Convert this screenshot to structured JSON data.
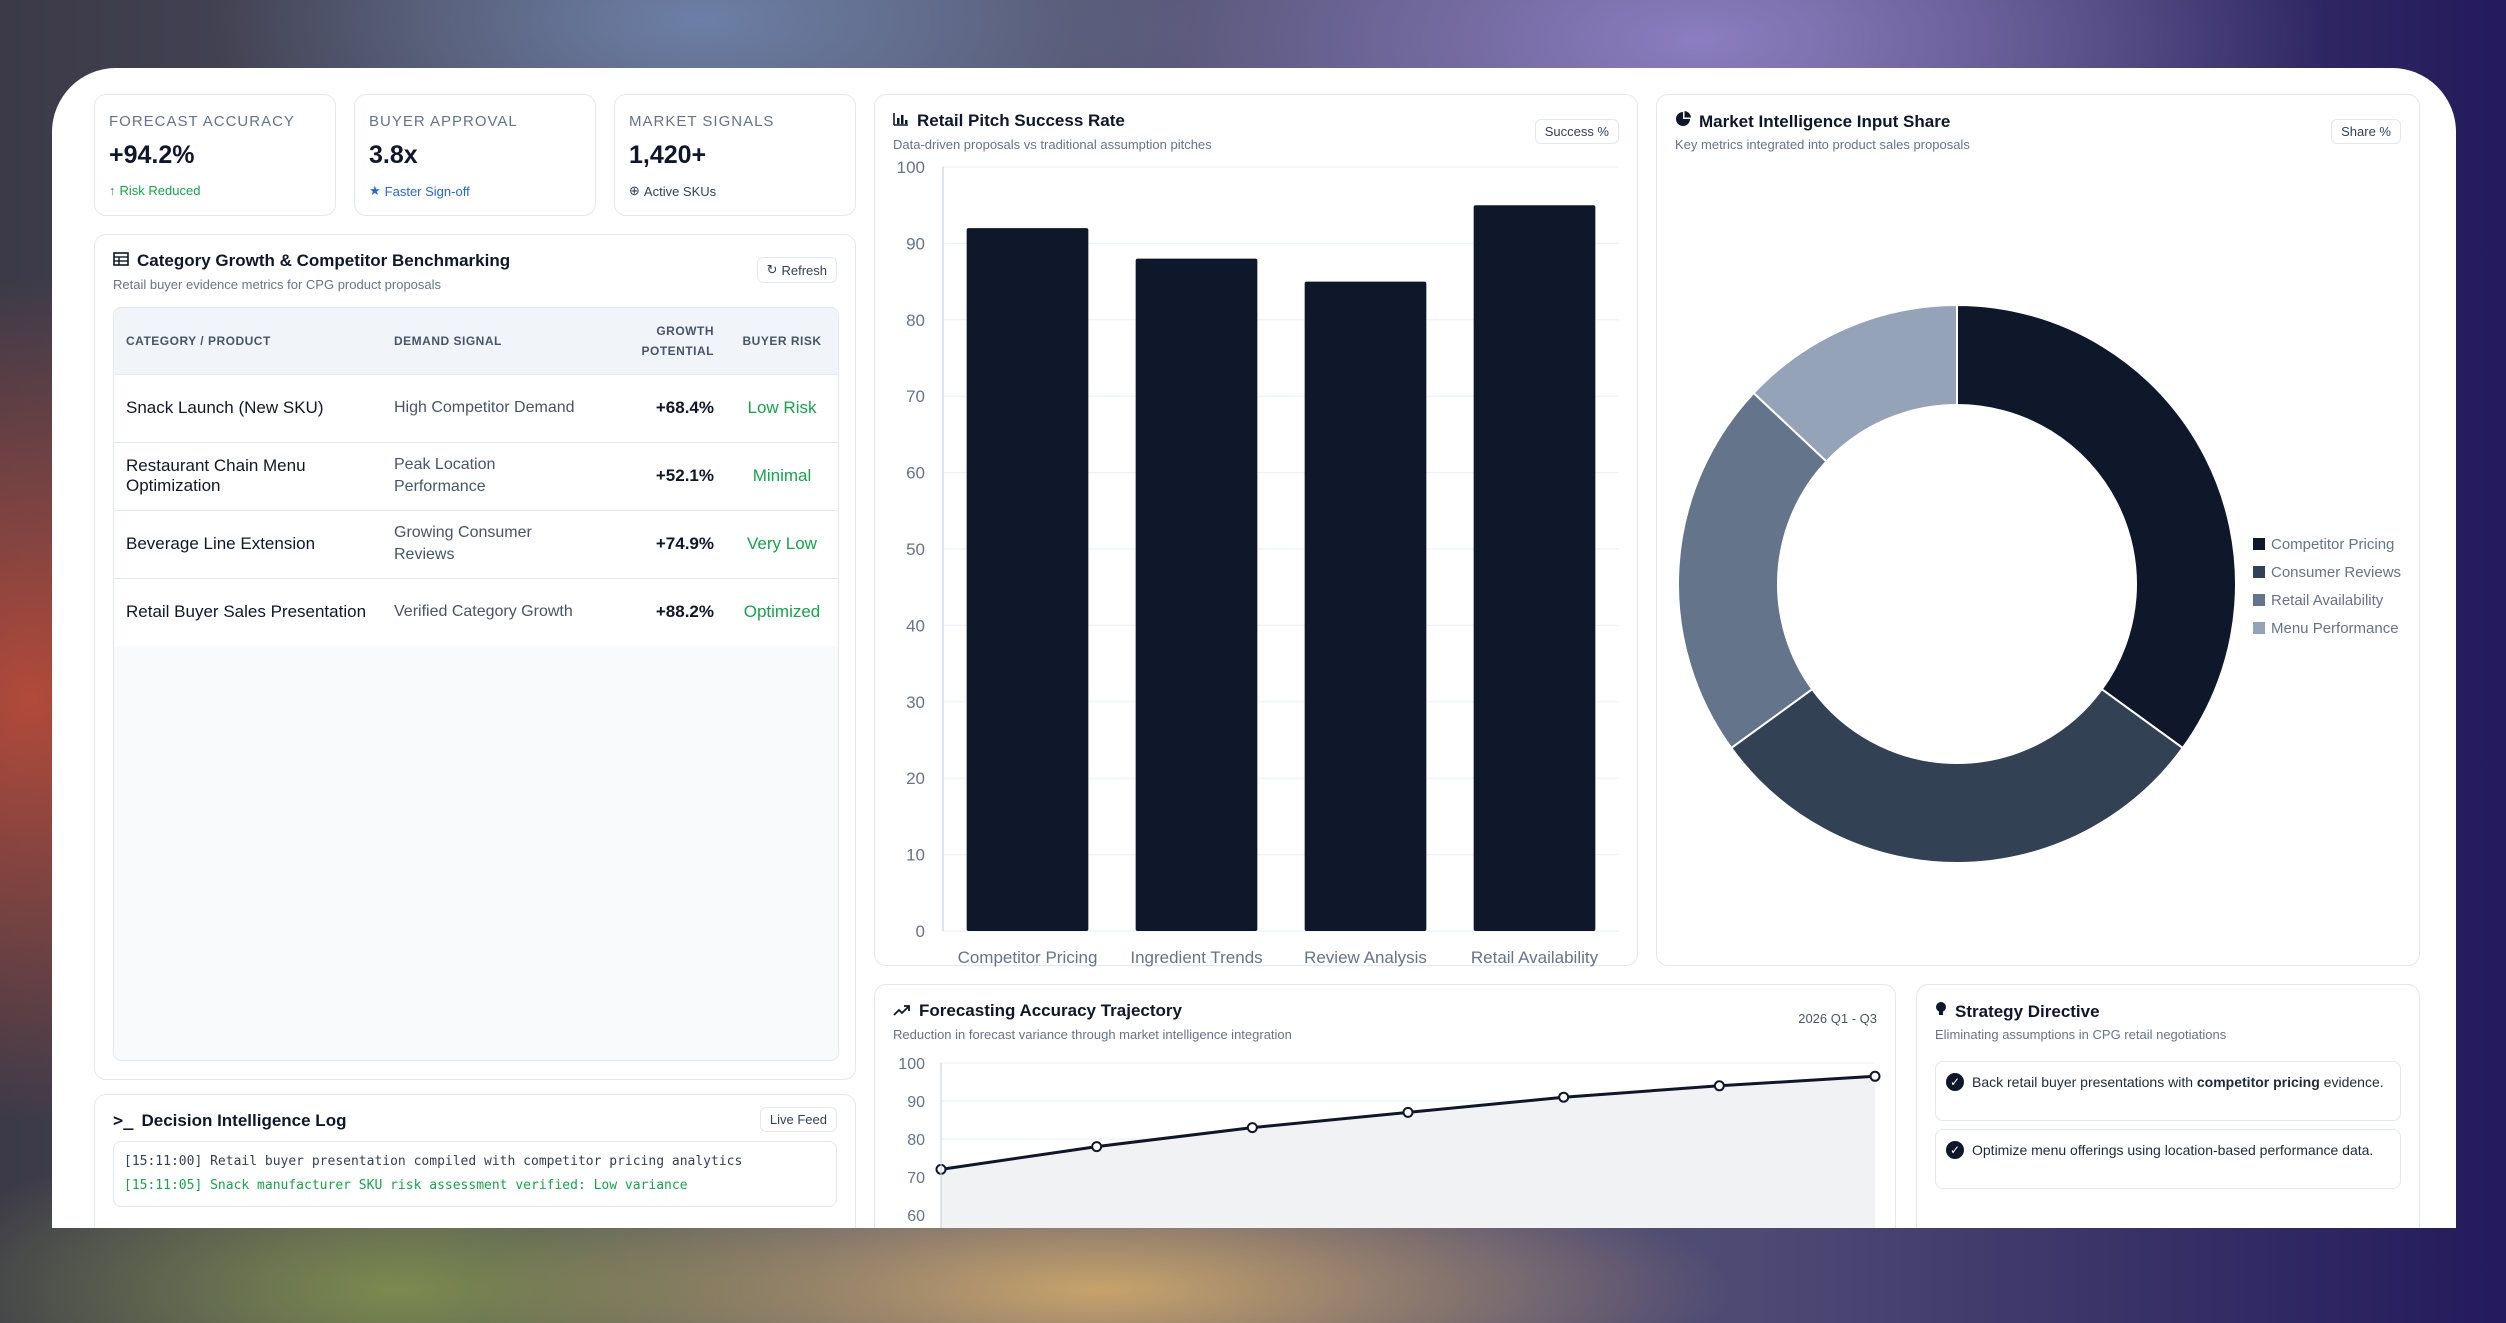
{
  "kpis": [
    {
      "label": "FORECAST ACCURACY",
      "value": "+94.2%",
      "foot": "Risk Reduced",
      "foot_icon": "arrow-up-icon"
    },
    {
      "label": "BUYER APPROVAL",
      "value": "3.8x",
      "foot": "Faster Sign-off",
      "foot_icon": "star-icon"
    },
    {
      "label": "MARKET SIGNALS",
      "value": "1,420+",
      "foot": "Active SKUs",
      "foot_icon": "globe-icon"
    }
  ],
  "benchmark": {
    "title": "Category Growth & Competitor Benchmarking",
    "subtitle": "Retail buyer evidence metrics for CPG product proposals",
    "refresh_label": "Refresh",
    "headers": [
      "CATEGORY / PRODUCT",
      "DEMAND SIGNAL",
      "GROWTH POTENTIAL",
      "BUYER RISK"
    ],
    "rows": [
      {
        "product": "Snack Launch (New SKU)",
        "signal": "High Competitor Demand",
        "growth": "+68.4%",
        "risk": "Low Risk"
      },
      {
        "product": "Restaurant Chain Menu Optimization",
        "signal": "Peak Location Performance",
        "growth": "+52.1%",
        "risk": "Minimal"
      },
      {
        "product": "Beverage Line Extension",
        "signal": "Growing Consumer Reviews",
        "growth": "+74.9%",
        "risk": "Very Low"
      },
      {
        "product": "Retail Buyer Sales Presentation",
        "signal": "Verified Category Growth",
        "growth": "+88.2%",
        "risk": "Optimized"
      }
    ]
  },
  "log": {
    "title": "Decision Intelligence Log",
    "badge": "Live Feed",
    "lines": [
      "[15:11:00] Retail buyer presentation compiled with competitor pricing analytics",
      "[15:11:05] Snack manufacturer SKU risk assessment verified: Low variance"
    ]
  },
  "pitch": {
    "title": "Retail Pitch Success Rate",
    "subtitle": "Data-driven proposals vs traditional assumption pitches",
    "badge": "Success %"
  },
  "share": {
    "title": "Market Intelligence Input Share",
    "subtitle": "Key metrics integrated into product sales proposals",
    "badge": "Share %"
  },
  "trajectory": {
    "title": "Forecasting Accuracy Trajectory",
    "subtitle": "Reduction in forecast variance through market intelligence integration",
    "badge": "2026 Q1 - Q3"
  },
  "strategy": {
    "title": "Strategy Directive",
    "subtitle": "Eliminating assumptions in CPG retail negotiations",
    "items": [
      {
        "pre": "Back retail buyer presentations with ",
        "bold": "competitor pricing",
        "post": " evidence."
      },
      {
        "pre": "Optimize menu offerings using location-based performance data.",
        "bold": "",
        "post": ""
      }
    ]
  },
  "colors": {
    "accent": "#0f172a",
    "success": "#16a34a",
    "info": "#2563eb"
  },
  "chart_data": [
    {
      "type": "bar",
      "categories": [
        "Competitor Pricing",
        "Ingredient Trends",
        "Review Analysis",
        "Retail Availability"
      ],
      "values": [
        92,
        88,
        85,
        95
      ],
      "ylim": [
        0,
        100
      ],
      "yticks": [
        0,
        10,
        20,
        30,
        40,
        50,
        60,
        70,
        80,
        90,
        100
      ],
      "grid": true
    },
    {
      "type": "pie",
      "donut": true,
      "labels": [
        "Competitor Pricing",
        "Consumer Reviews",
        "Retail Availability",
        "Menu Performance"
      ],
      "values": [
        35,
        30,
        22,
        13
      ],
      "colors": [
        "#0f172a",
        "#334155",
        "#64748b",
        "#94a3b8"
      ],
      "legend": "right"
    },
    {
      "type": "area",
      "x": [
        1,
        2,
        3,
        4,
        5,
        6,
        7
      ],
      "values": [
        72,
        78,
        83,
        87,
        91,
        94,
        96.5
      ],
      "yticks": [
        60,
        70,
        80,
        90,
        100
      ],
      "ylim": [
        60,
        100
      ],
      "grid": true
    }
  ]
}
